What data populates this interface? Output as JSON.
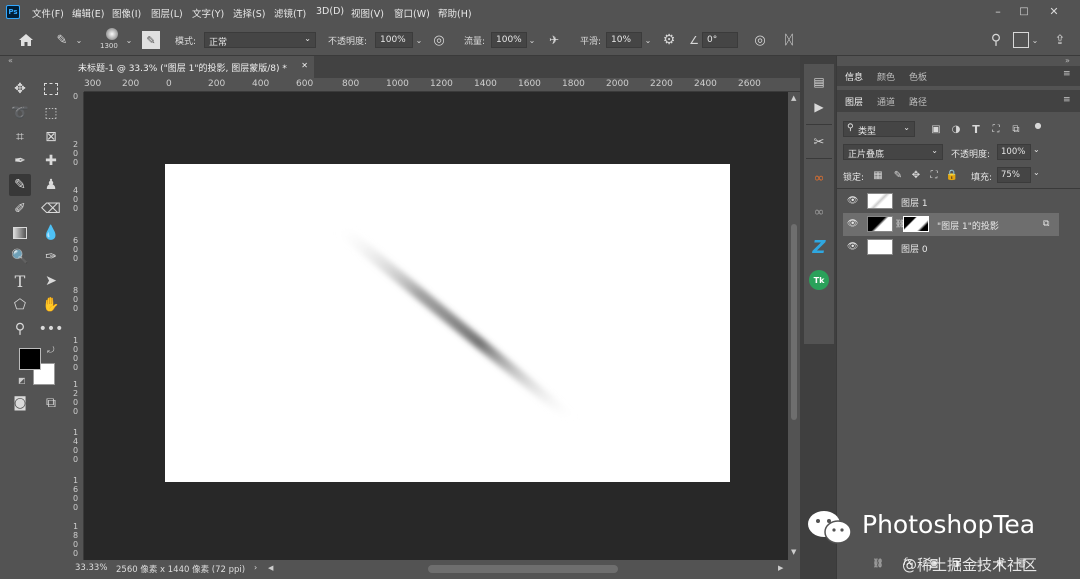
{
  "app": {
    "logo": "Ps"
  },
  "menu": [
    "文件(F)",
    "编辑(E)",
    "图像(I)",
    "图层(L)",
    "文字(Y)",
    "选择(S)",
    "滤镜(T)",
    "3D(D)",
    "视图(V)",
    "窗口(W)",
    "帮助(H)"
  ],
  "options": {
    "brush_size": "1300",
    "mode_label": "模式:",
    "mode_value": "正常",
    "opacity_label": "不透明度:",
    "opacity_value": "100%",
    "flow_label": "流量:",
    "flow_value": "100%",
    "smooth_label": "平滑:",
    "smooth_value": "10%",
    "angle_value": "0°"
  },
  "document": {
    "tab_title": "未标题-1 @ 33.3% (\"图层 1\"的投影, 图层蒙版/8) *",
    "ruler_top": [
      "300",
      "200",
      "0",
      "200",
      "400",
      "600",
      "800",
      "1000",
      "1200",
      "1400",
      "1600",
      "1800",
      "2000",
      "2200",
      "2400",
      "2600"
    ],
    "ruler_left": [
      "0",
      "2",
      "0",
      "0",
      "4",
      "0",
      "0",
      "6",
      "0",
      "0",
      "8",
      "0",
      "0",
      "1",
      "0",
      "0",
      "0",
      "1",
      "2",
      "0",
      "0",
      "1",
      "4",
      "0",
      "0",
      "1",
      "6",
      "0",
      "0",
      "1",
      "8",
      "0",
      "0"
    ],
    "zoom": "33.33%",
    "doc_info": "2560 像素 x 1440 像素 (72 ppi)"
  },
  "panels": {
    "top_tabs": [
      "信息",
      "颜色",
      "色板"
    ],
    "layer_tabs": [
      "图层",
      "通道",
      "路径"
    ],
    "filter_kind": "类型",
    "blend_mode": "正片叠底",
    "opacity_label": "不透明度:",
    "opacity_value": "100%",
    "lock_label": "锁定:",
    "fill_label": "填充:",
    "fill_value": "75%",
    "layers": [
      {
        "name": "图层 1"
      },
      {
        "name": "\"图层 1\"的投影"
      },
      {
        "name": "图层 0"
      }
    ],
    "footer_fx": "fx"
  },
  "watermark": {
    "brand": "PhotoshopTea",
    "sub": "@稀土掘金技术社区"
  }
}
